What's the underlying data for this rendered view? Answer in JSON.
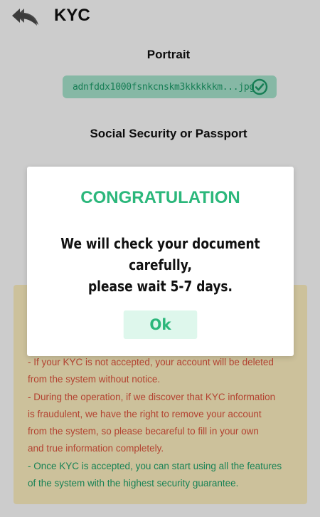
{
  "header": {
    "title": "KYC",
    "back_icon": "back-arrows-icon"
  },
  "portrait": {
    "title": "Portrait",
    "file_name": "adnfddx1000fsnkcnskm3kkkkkkm...jpg",
    "status_icon": "check-circle-icon"
  },
  "ssn": {
    "title": "Social Security or Passport"
  },
  "info": {
    "lines": [
      "- If your KYC is not accepted, your account will be deleted",
      "from the system without notice.",
      "- During the operation, if we discover that KYC information",
      "is fraudulent, we have the right to remove your account",
      "from the system, so please becareful to fill in your own",
      "and true information completely.",
      "- Once KYC is accepted, you can start using all the features",
      "of the system with the highest security guarantee."
    ]
  },
  "modal": {
    "title": "CONGRATULATION",
    "message_line1": "We will check your document carefully,",
    "message_line2": "please wait 5-7 days.",
    "ok_label": "Ok"
  },
  "colors": {
    "accent_green": "#2bb77b",
    "chip_bg": "#a8e6cf",
    "panel_bg": "#fff2c2",
    "warn_red": "#e0543e",
    "good_green": "#1fa36b"
  }
}
